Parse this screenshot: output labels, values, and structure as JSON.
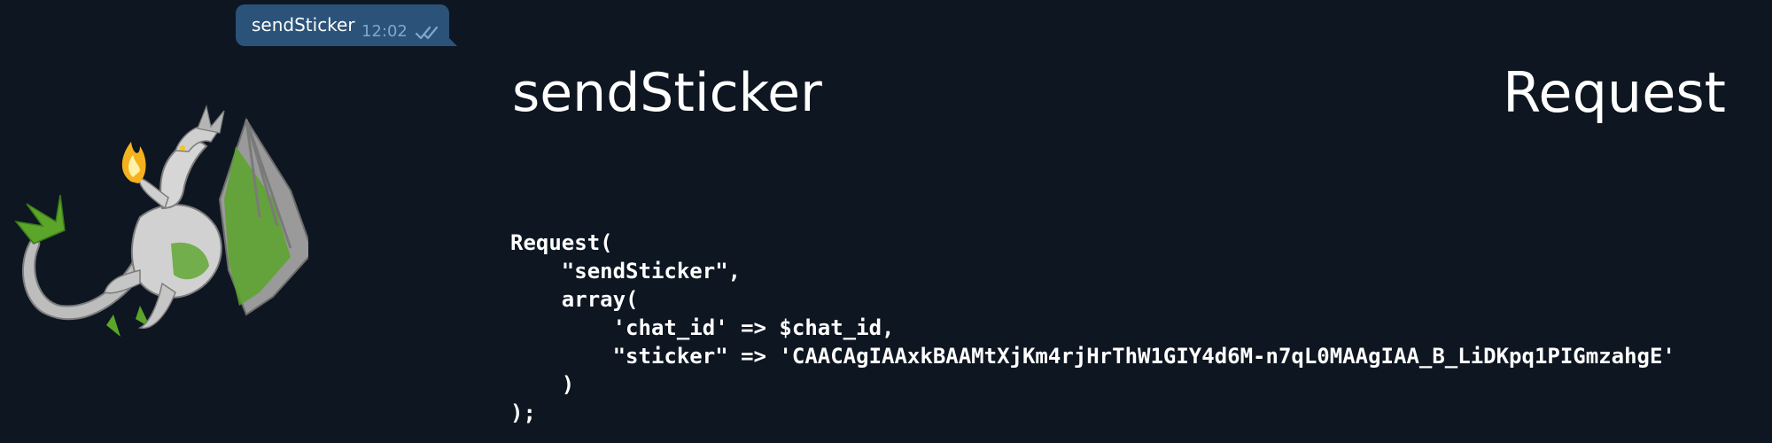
{
  "message": {
    "text": "sendSticker",
    "time": "12:02",
    "status_icon": "double-check-icon"
  },
  "sticker": {
    "icon": "dragon-sticker",
    "colors": {
      "body": "#c9c9c9",
      "wing_membrane": "#5aa52a",
      "flame": "#f5b21e"
    }
  },
  "header": {
    "title": "sendSticker",
    "kind": "Request"
  },
  "code": {
    "lines": [
      "Request(",
      "    \"sendSticker\",",
      "    array(",
      "        'chat_id' => $chat_id,",
      "        \"sticker\" => 'CAACAgIAAxkBAAMtXjKm4rjHrThW1GIY4d6M-n7qL0MAAgIAA_B_LiDKpq1PIGmzahgE'",
      "    )",
      ");"
    ]
  },
  "colors": {
    "background": "#0e1621",
    "bubble": "#2b5278",
    "meta_text": "#7fa8d0"
  }
}
